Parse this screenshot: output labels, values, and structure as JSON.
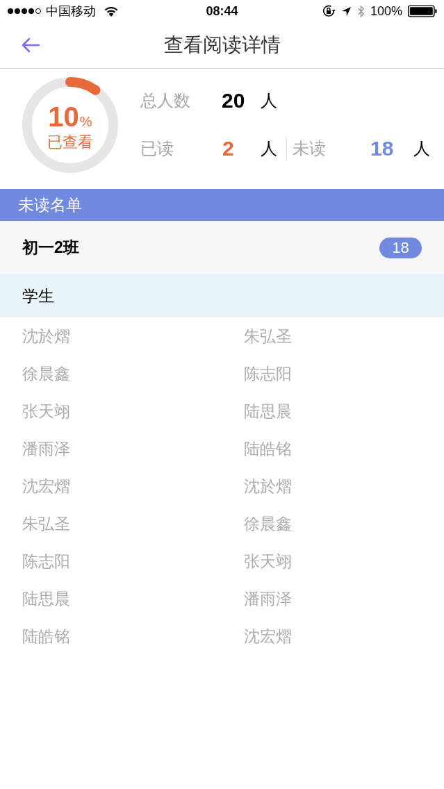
{
  "status_bar": {
    "carrier": "中国移动",
    "time": "08:44",
    "battery": "100%"
  },
  "nav": {
    "title": "查看阅读详情"
  },
  "summary": {
    "ring": {
      "level": 0.1,
      "percent": "10",
      "percent_sign": "%",
      "caption": "已查看"
    },
    "total": {
      "label": "总人数",
      "value": "20",
      "unit": "人"
    },
    "read": {
      "label": "已读",
      "value": "2",
      "unit": "人"
    },
    "unread": {
      "label": "未读",
      "value": "18",
      "unit": "人"
    }
  },
  "section_title": "未读名单",
  "group": {
    "name": "初一2班",
    "count": "18"
  },
  "subheader": "学生",
  "students": [
    "沈於熠",
    "朱弘圣",
    "徐晨鑫",
    "陈志阳",
    "张天翊",
    "陆思晨",
    "潘雨泽",
    "陆皓铭",
    "沈宏熠",
    "沈於熠",
    "朱弘圣",
    "徐晨鑫",
    "陈志阳",
    "张天翊",
    "陆思晨",
    "潘雨泽",
    "陆皓铭",
    "沈宏熠"
  ]
}
